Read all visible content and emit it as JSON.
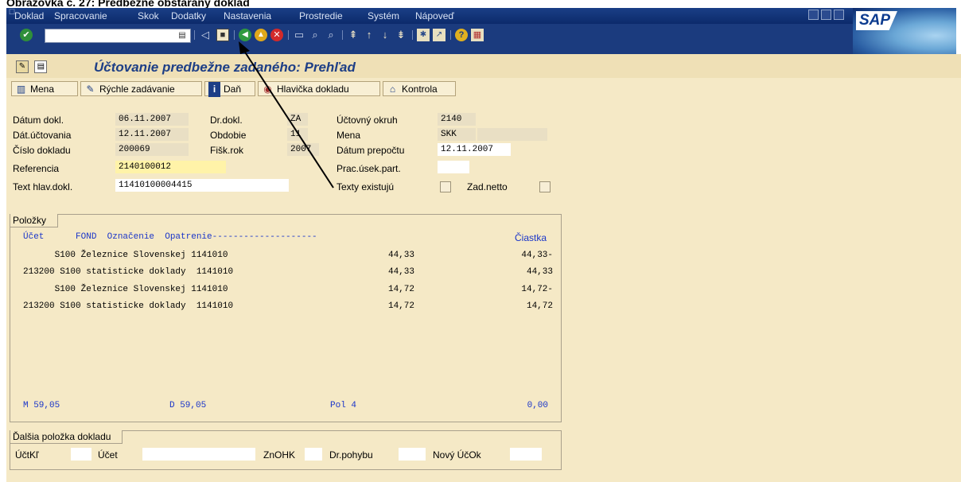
{
  "caption": "Obrazovka č. 27: Predbežne obstaraný doklad",
  "menu": [
    "Doklad",
    "Spracovanie",
    "Skok",
    "Dodatky",
    "Nastavenia",
    "Prostredie",
    "Systém",
    "Nápoveď"
  ],
  "logo_text": "SAP",
  "title": "Účtovanie predbežne zadaného: Prehľad",
  "appbar": {
    "mena": "Mena",
    "rychle": "Rýchle zadávanie",
    "dan": "Daň",
    "hlavicka": "Hlavička dokladu",
    "kontrola": "Kontrola"
  },
  "header": {
    "datum_dokl_label": "Dátum dokl.",
    "datum_dokl": "06.11.2007",
    "dat_uct_label": "Dát.účtovania",
    "dat_uct": "12.11.2007",
    "cislo_label": "Číslo dokladu",
    "cislo": "200069",
    "referencia_label": "Referencia",
    "referencia": "2140100012",
    "text_label": "Text hlav.dokl.",
    "text": "11410100004415",
    "drdokl_label": "Dr.dokl.",
    "drdokl": "ZA",
    "obdobie_label": "Obdobie",
    "obdobie": "11",
    "fiskrok_label": "Fišk.rok",
    "fiskrok": "2007",
    "uctovny_label": "Účtovný okruh",
    "uctovny": "2140",
    "mena_label": "Mena",
    "mena": "SKK",
    "prepocet_label": "Dátum prepočtu",
    "prepocet": "12.11.2007",
    "pracusek_label": "Prac.úsek.part.",
    "texty_label": "Texty existujú",
    "zadnetto_label": "Zad.netto"
  },
  "polozky": {
    "tab": "Položky",
    "header_left": "Účet      FOND  Označenie  Opatrenie--------------------",
    "header_right": "Čiastka",
    "rows": [
      {
        "left": "      S100 Železnice Slovenskej 1141010",
        "mid": "44,33",
        "amount": "44,33-"
      },
      {
        "left": "213200 S100 statisticke doklady  1141010",
        "mid": "44,33",
        "amount": "44,33"
      },
      {
        "left": "      S100 Železnice Slovenskej 1141010",
        "mid": "14,72",
        "amount": "14,72-"
      },
      {
        "left": "213200 S100 statisticke doklady  1141010",
        "mid": "14,72",
        "amount": "14,72"
      }
    ],
    "sum_m": "M 59,05",
    "sum_d": "D 59,05",
    "pol": "Pol 4",
    "zero": "0,00"
  },
  "dalsia": {
    "tab": "Ďalšia položka dokladu",
    "uctkl_label": "ÚčtKľ",
    "ucet_label": "Účet",
    "znohk_label": "ZnOHK",
    "drpohybu_label": "Dr.pohybu",
    "novy_label": "Nový ÚčOk"
  },
  "icons": [
    "check-icon",
    "save-icon",
    "back-icon",
    "exit-icon",
    "cancel-icon",
    "print-icon",
    "find-icon",
    "find-next-icon",
    "first-page-icon",
    "prev-page-icon",
    "next-page-icon",
    "last-page-icon",
    "new-session-icon",
    "shortcut-icon",
    "help-icon",
    "layout-icon"
  ]
}
